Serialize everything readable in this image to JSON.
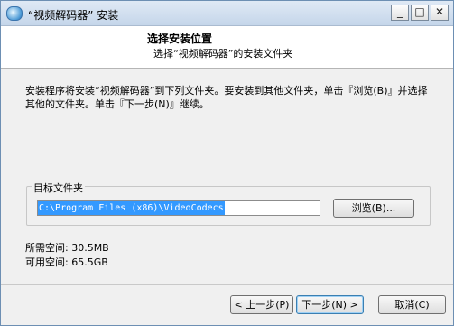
{
  "window": {
    "title": "“视频解码器” 安装",
    "minimize_label": "_",
    "maximize_label": "□",
    "close_label": "✕"
  },
  "header": {
    "title": "选择安装位置",
    "subtitle": "选择“视频解码器”的安装文件夹"
  },
  "instructions": "安装程序将安装“视频解码器”到下列文件夹。要安装到其他文件夹，单击『浏览(B)』并选择其他的文件夹。单击『下一步(N)』继续。",
  "target_group": {
    "label": "目标文件夹",
    "path_value": "C:\\Program Files (x86)\\VideoCodecs",
    "browse_label": "浏览(B)..."
  },
  "space": {
    "required": "所需空间: 30.5MB",
    "available": "可用空间: 65.5GB"
  },
  "buttons": {
    "back": "< 上一步(P)",
    "next": "下一步(N) >",
    "cancel": "取消(C)"
  }
}
